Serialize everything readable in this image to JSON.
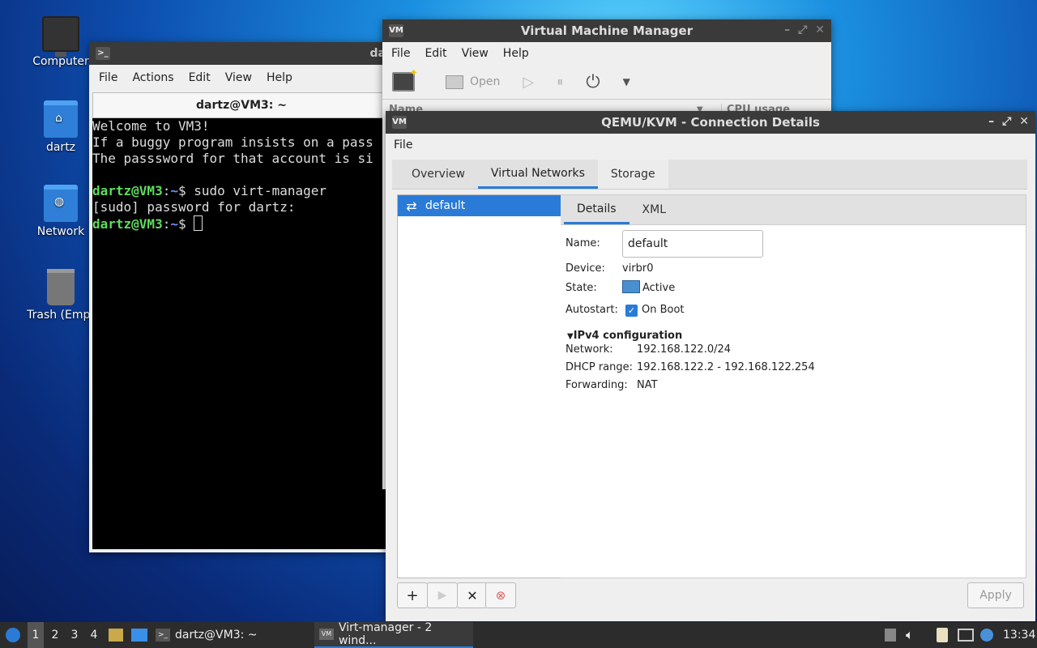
{
  "desktop": {
    "icons": [
      {
        "label": "Computer",
        "icon": "computer-icon"
      },
      {
        "label": "dartz",
        "icon": "home-folder-icon"
      },
      {
        "label": "Network",
        "icon": "network-icon"
      },
      {
        "label": "Trash (Empt",
        "icon": "trash-icon"
      }
    ]
  },
  "terminal": {
    "title": "dartz@VM3: ~",
    "title_partial": "da",
    "menu": [
      "File",
      "Actions",
      "Edit",
      "View",
      "Help"
    ],
    "tab_title": "dartz@VM3: ~",
    "lines": [
      "Welcome to VM3!",
      "If a buggy program insists on a pass",
      "The passsword for that account is si",
      ""
    ],
    "prompt_user": "dartz@VM3",
    "prompt_path": "~",
    "command": "sudo virt-manager",
    "sudo_line": "[sudo] password for dartz:"
  },
  "vmm": {
    "title": "Virtual Machine Manager",
    "menu": [
      "File",
      "Edit",
      "View",
      "Help"
    ],
    "toolbar": {
      "open": "Open"
    },
    "columns": {
      "name": "Name",
      "cpu": "CPU usage"
    }
  },
  "conn": {
    "title": "QEMU/KVM - Connection Details",
    "menu": [
      "File"
    ],
    "tabs": [
      "Overview",
      "Virtual Networks",
      "Storage"
    ],
    "active_tab": "Virtual Networks",
    "networks": [
      {
        "name": "default"
      }
    ],
    "subtabs": [
      "Details",
      "XML"
    ],
    "details": {
      "name_label": "Name:",
      "name_value": "default",
      "device_label": "Device:",
      "device_value": "virbr0",
      "state_label": "State:",
      "state_value": "Active",
      "autostart_label": "Autostart:",
      "autostart_value": "On Boot",
      "ipv4_header": "IPv4 configuration",
      "network_label": "Network:",
      "network_value": "192.168.122.0/24",
      "dhcp_label": "DHCP range:",
      "dhcp_value": "192.168.122.2 - 192.168.122.254",
      "forwarding_label": "Forwarding:",
      "forwarding_value": "NAT"
    },
    "apply_label": "Apply"
  },
  "taskbar": {
    "workspaces": [
      "1",
      "2",
      "3",
      "4"
    ],
    "tasks": [
      {
        "label": "dartz@VM3: ~"
      },
      {
        "label": "Virt-manager - 2 wind..."
      }
    ],
    "clock": "13:34"
  },
  "colors": {
    "accent": "#2a7bd7",
    "titlebar": "#3a3a3a",
    "taskbar": "#2c2c2c",
    "prompt_green": "#5fdc5f"
  }
}
